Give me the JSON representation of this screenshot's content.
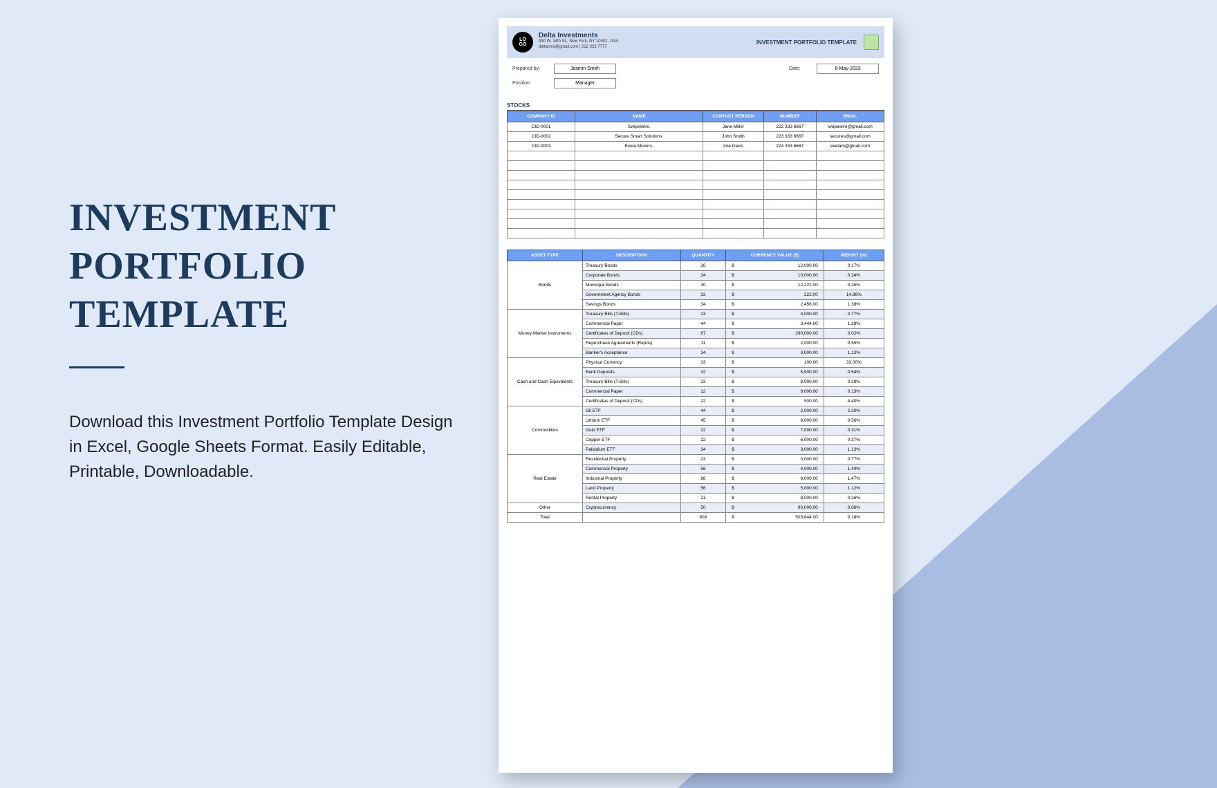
{
  "page": {
    "title_line1": "INVESTMENT",
    "title_line2": "PORTFOLIO TEMPLATE",
    "description": "Download this Investment Portfolio Template Design in Excel, Google Sheets Format. Easily Editable, Printable, Downloadable."
  },
  "doc": {
    "logo_top": "LO",
    "logo_bottom": "GO",
    "company": "Delta Investments",
    "address": "330 W. 34th St., New York, NY 10001, USA.",
    "contact": "deltainvs@gmail.com | 222 333 7777",
    "doc_title": "INVESTMENT PORTFOLIO TEMPLATE",
    "prepared_label": "Prepared by:",
    "prepared_value": "Jasmin Smith",
    "position_label": "Position:",
    "position_value": "Manager",
    "date_label": "Date:",
    "date_value": "6-May-2023",
    "stocks_title": "STOCKS",
    "stocks_headers": [
      "COMPANY ID",
      "NAME",
      "CONTACT PERSON",
      "NUMBER",
      "EMAIL"
    ],
    "stocks_rows": [
      [
        "CID-0001",
        "SwipeWire.",
        "Jane Miller",
        "222 333 6667",
        "swipewire@gmail.com"
      ],
      [
        "CID-0002",
        "Secure Smart Solutions.",
        "John Smith",
        "223 333 6667",
        "secures@gmail.com"
      ],
      [
        "CID-0003",
        "Exela Movers.",
        "Zoe Davis",
        "224 333 6667",
        "exelam@gmail.com"
      ]
    ],
    "stocks_empty_rows": 9,
    "assets_headers": [
      "ASSET TYPE",
      "DESCRIPTION",
      "QUANTITY",
      "CURRENCY VALUE ($)",
      "WEIGHT (%)"
    ],
    "asset_groups": [
      {
        "type": "Bonds",
        "rows": [
          {
            "desc": "Treasury Bonds",
            "qty": "20",
            "val": "12,000.00",
            "wt": "0.17%"
          },
          {
            "desc": "Corporate Bonds",
            "qty": "24",
            "val": "10,000.00",
            "wt": "0.24%"
          },
          {
            "desc": "Municipal Bonds",
            "qty": "30",
            "val": "12,222.00",
            "wt": "0.25%"
          },
          {
            "desc": "Government Agency Bonds",
            "qty": "33",
            "val": "222.00",
            "wt": "14.86%"
          },
          {
            "desc": "Savings Bonds",
            "qty": "34",
            "val": "2,456.00",
            "wt": "1.38%"
          }
        ]
      },
      {
        "type": "Money Market Instruments",
        "rows": [
          {
            "desc": "Treasury Bills (T-Bills)",
            "qty": "23",
            "val": "3,000.00",
            "wt": "0.77%"
          },
          {
            "desc": "Commercial Paper",
            "qty": "44",
            "val": "3,444.00",
            "wt": "1.28%"
          },
          {
            "desc": "Certificates of Deposit (CDs)",
            "qty": "67",
            "val": "290,000.00",
            "wt": "0.02%"
          },
          {
            "desc": "Repurchase Agreements (Repos)",
            "qty": "11",
            "val": "2,000.00",
            "wt": "0.55%"
          },
          {
            "desc": "Banker's Acceptance",
            "qty": "34",
            "val": "3,000.00",
            "wt": "1.13%"
          }
        ]
      },
      {
        "type": "Cash and Cash Equivalents",
        "rows": [
          {
            "desc": "Physical Currency",
            "qty": "33",
            "val": "100.00",
            "wt": "33.00%"
          },
          {
            "desc": "Bank Deposits",
            "qty": "32",
            "val": "5,900.00",
            "wt": "0.54%"
          },
          {
            "desc": "Treasury Bills (T-Bills)",
            "qty": "23",
            "val": "8,000.00",
            "wt": "0.29%"
          },
          {
            "desc": "Commercial Paper",
            "qty": "12",
            "val": "9,000.00",
            "wt": "0.13%"
          },
          {
            "desc": "Certificates of Deposit (CDs)",
            "qty": "22",
            "val": "500.00",
            "wt": "4.40%"
          }
        ]
      },
      {
        "type": "Commodities",
        "rows": [
          {
            "desc": "Oil ETF",
            "qty": "44",
            "val": "2,000.00",
            "wt": "2.20%"
          },
          {
            "desc": "Lithium ETF",
            "qty": "45",
            "val": "8,000.00",
            "wt": "0.56%"
          },
          {
            "desc": "Gold ETF",
            "qty": "22",
            "val": "7,000.00",
            "wt": "0.31%"
          },
          {
            "desc": "Copper ETF",
            "qty": "22",
            "val": "6,000.00",
            "wt": "0.37%"
          },
          {
            "desc": "Palladium ETF",
            "qty": "34",
            "val": "3,000.00",
            "wt": "1.13%"
          }
        ]
      },
      {
        "type": "Real Estate",
        "rows": [
          {
            "desc": "Residential Property",
            "qty": "23",
            "val": "3,000.00",
            "wt": "0.77%"
          },
          {
            "desc": "Commercial Property",
            "qty": "56",
            "val": "4,000.00",
            "wt": "1.40%"
          },
          {
            "desc": "Industrial Property",
            "qty": "88",
            "val": "6,000.00",
            "wt": "1.47%"
          },
          {
            "desc": "Land Property",
            "qty": "56",
            "val": "5,000.00",
            "wt": "1.12%"
          },
          {
            "desc": "Rental Property",
            "qty": "21",
            "val": "8,000.00",
            "wt": "0.26%"
          }
        ]
      },
      {
        "type": "Other",
        "rows": [
          {
            "desc": "Cryptocurrency",
            "qty": "50",
            "val": "90,000.00",
            "wt": "0.06%"
          }
        ]
      }
    ],
    "total_label": "Total",
    "total_qty": "903",
    "total_val": "503,844.00",
    "total_wt": "0.18%",
    "currency_symbol": "$"
  }
}
